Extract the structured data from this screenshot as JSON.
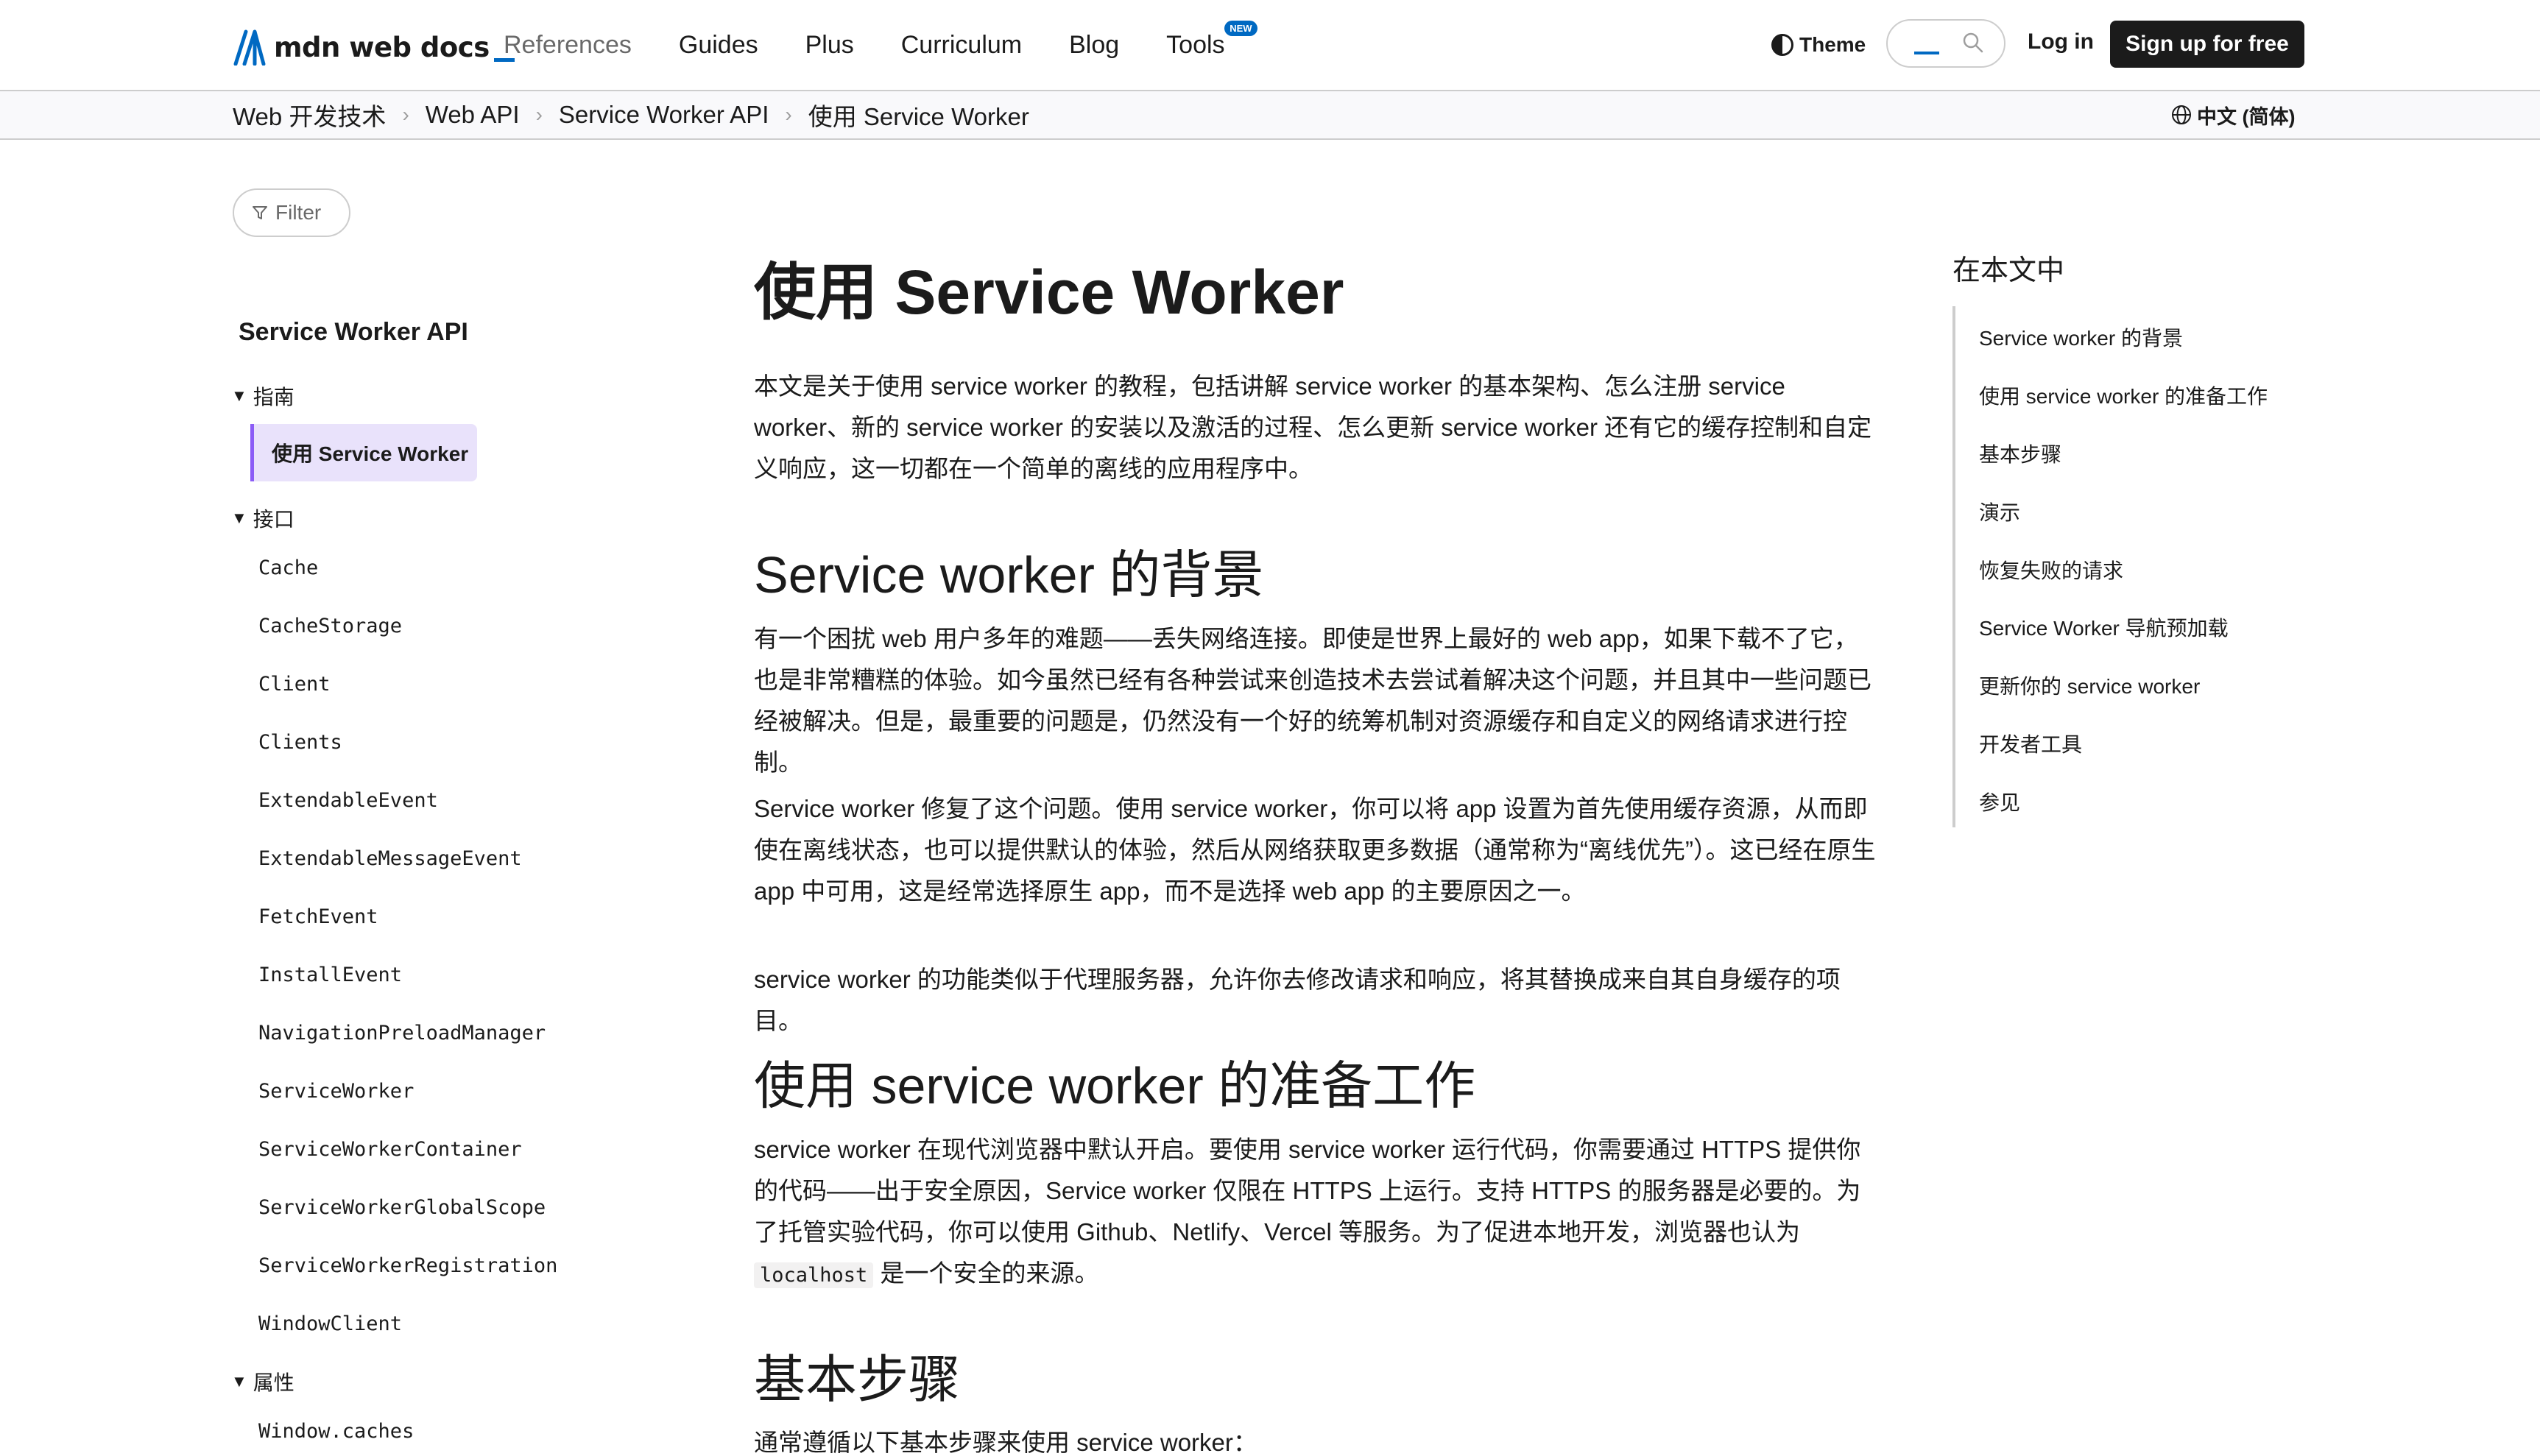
{
  "header": {
    "logo_text": "mdn web docs",
    "nav": [
      {
        "label": "References"
      },
      {
        "label": "Guides"
      },
      {
        "label": "Plus"
      },
      {
        "label": "Curriculum"
      },
      {
        "label": "Blog"
      },
      {
        "label": "Tools",
        "badge": "NEW"
      }
    ],
    "theme_label": "Theme",
    "login_label": "Log in",
    "signup_label": "Sign up for free"
  },
  "breadcrumb": {
    "items": [
      "Web 开发技术",
      "Web API",
      "Service Worker API",
      "使用 Service Worker"
    ],
    "language": "中文 (简体)"
  },
  "sidebar": {
    "filter_label": "Filter",
    "title": "Service Worker API",
    "group_guides": "指南",
    "active_item": "使用 Service Worker",
    "group_interfaces": "接口",
    "interfaces": [
      "Cache",
      "CacheStorage",
      "Client",
      "Clients",
      "ExtendableEvent",
      "ExtendableMessageEvent",
      "FetchEvent",
      "InstallEvent",
      "NavigationPreloadManager",
      "ServiceWorker",
      "ServiceWorkerContainer",
      "ServiceWorkerGlobalScope",
      "ServiceWorkerRegistration",
      "WindowClient"
    ],
    "group_properties": "属性",
    "properties": [
      "Window.caches"
    ]
  },
  "article": {
    "title": "使用 Service Worker",
    "intro": "本文是关于使用 service worker 的教程，包括讲解 service worker 的基本架构、怎么注册 service worker、新的 service worker 的安装以及激活的过程、怎么更新 service worker 还有它的缓存控制和自定义响应，这一切都在一个简单的离线的应用程序中。",
    "h2_background": "Service worker 的背景",
    "p_bg_1": "有一个困扰 web 用户多年的难题——丢失网络连接。即使是世界上最好的 web app，如果下载不了它，也是非常糟糕的体验。如今虽然已经有各种尝试来创造技术去尝试着解决这个问题，并且其中一些问题已经被解决。但是，最重要的问题是，仍然没有一个好的统筹机制对资源缓存和自定义的网络请求进行控制。",
    "p_bg_2": "Service worker 修复了这个问题。使用 service worker，你可以将 app 设置为首先使用缓存资源，从而即使在离线状态，也可以提供默认的体验，然后从网络获取更多数据（通常称为“离线优先”）。这已经在原生 app 中可用，这是经常选择原生 app，而不是选择 web app 的主要原因之一。",
    "p_bg_3": "service worker 的功能类似于代理服务器，允许你去修改请求和响应，将其替换成来自其自身缓存的项目。",
    "h2_prep": "使用 service worker 的准备工作",
    "p_prep_before": "service worker 在现代浏览器中默认开启。要使用 service worker 运行代码，你需要通过 HTTPS 提供你的代码——出于安全原因，Service worker 仅限在 HTTPS 上运行。支持 HTTPS 的服务器是必要的。为了托管实验代码，你可以使用 Github、Netlify、Vercel 等服务。为了促进本地开发，浏览器也认为 ",
    "p_prep_code": "localhost",
    "p_prep_after": " 是一个安全的来源。",
    "h2_steps": "基本步骤",
    "p_steps": "通常遵循以下基本步骤来使用 service worker："
  },
  "toc": {
    "title": "在本文中",
    "items": [
      "Service worker 的背景",
      "使用 service worker 的准备工作",
      "基本步骤",
      "演示",
      "恢复失败的请求",
      "Service Worker 导航预加载",
      "更新你的 service worker",
      "开发者工具",
      "参见"
    ]
  },
  "colors": {
    "accent": "#0069c2",
    "active_bg": "#e9e2fb",
    "active_border": "#8b5cf6",
    "signup_bg": "#1b1b1b"
  }
}
